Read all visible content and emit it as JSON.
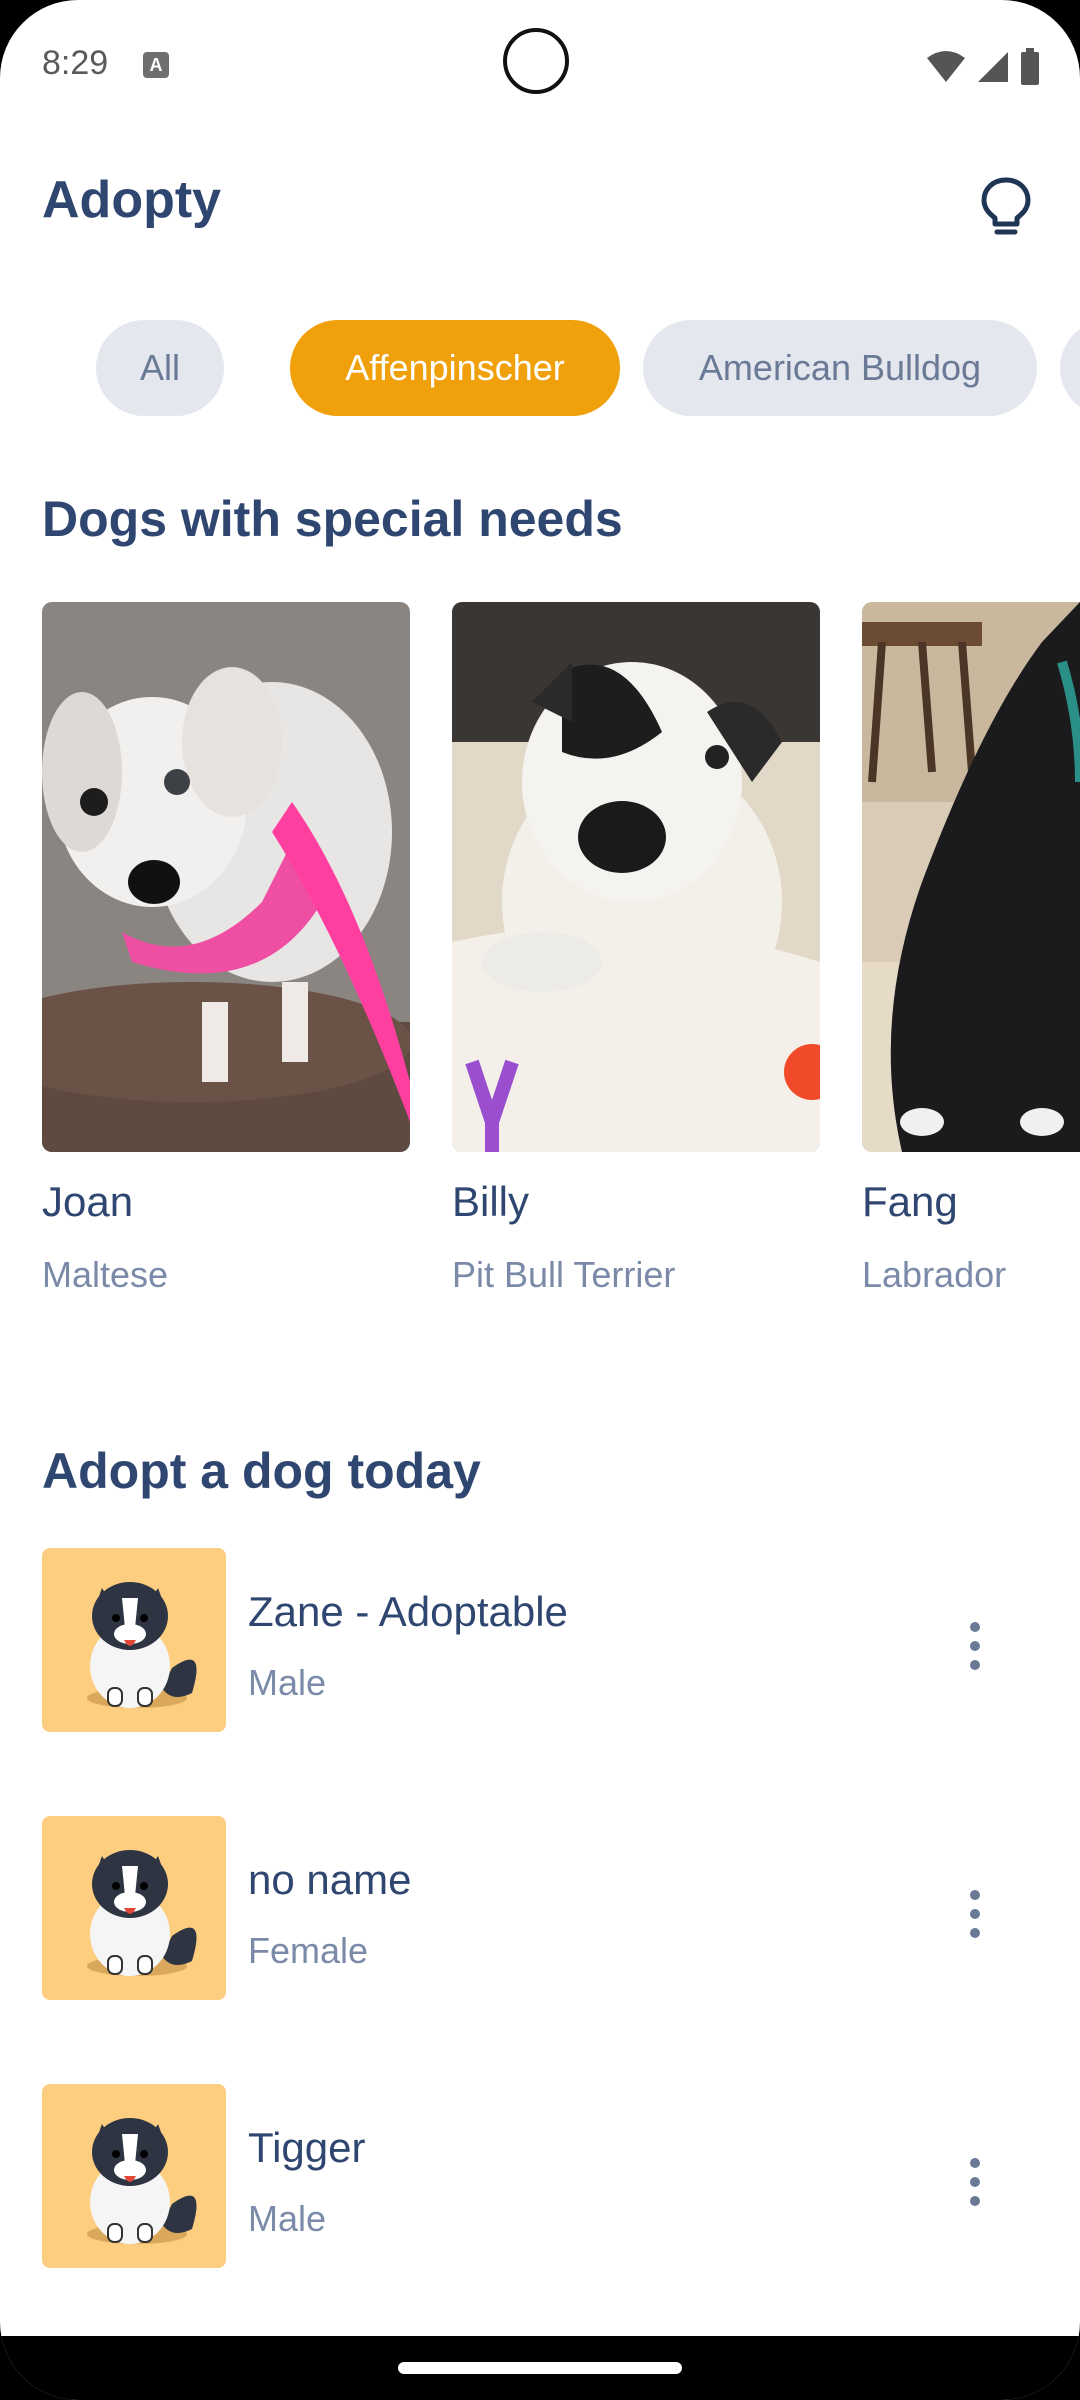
{
  "status_bar": {
    "time": "8:29",
    "a_badge": "A"
  },
  "app": {
    "title": "Adopty",
    "bulb_icon": "lightbulb-icon"
  },
  "chips": [
    {
      "label": "All"
    },
    {
      "label": "Affenpinscher"
    },
    {
      "label": "American Bulldog"
    }
  ],
  "special_needs": {
    "title": "Dogs with special needs",
    "dogs": [
      {
        "name": "Joan",
        "breed": "Maltese"
      },
      {
        "name": "Billy",
        "breed": "Pit Bull Terrier"
      },
      {
        "name": "Fang",
        "breed": "Labrador"
      }
    ]
  },
  "adopt_today": {
    "title": "Adopt a dog today",
    "dogs": [
      {
        "name": "Zane - Adoptable",
        "gender": "Male"
      },
      {
        "name": "no name",
        "gender": "Female"
      },
      {
        "name": "Tigger",
        "gender": "Male"
      }
    ]
  },
  "colors": {
    "accent": "#f0a00a",
    "title": "#2f4770",
    "thumb_bg": "#fdcd80"
  }
}
